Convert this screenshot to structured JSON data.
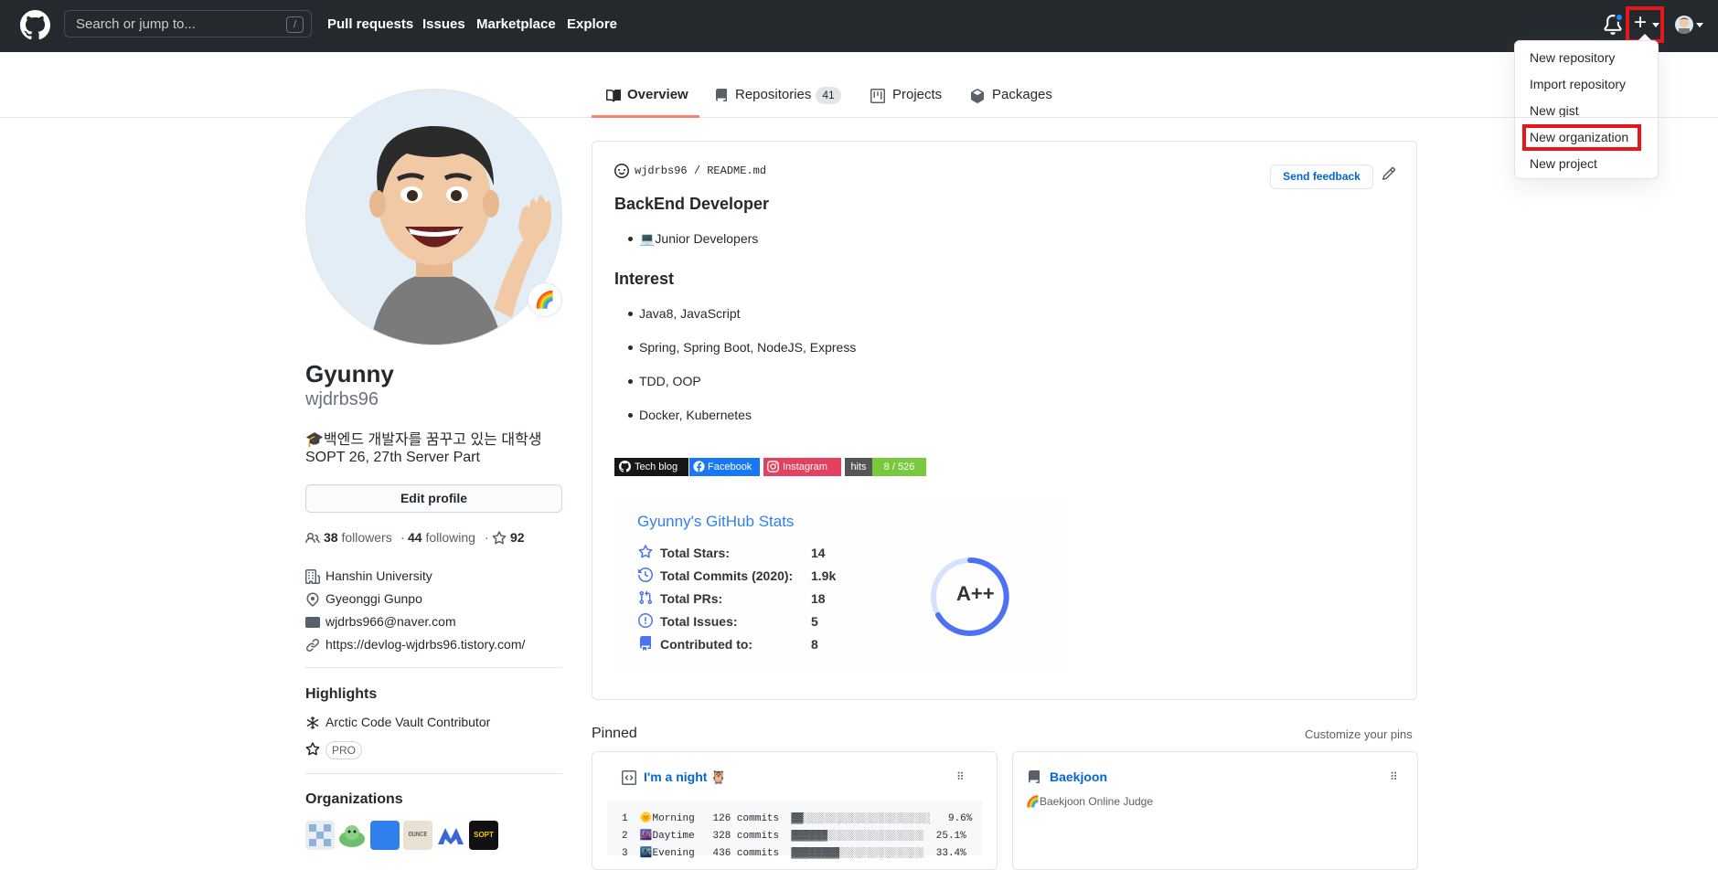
{
  "header": {
    "search_placeholder": "Search or jump to...",
    "slash": "/",
    "nav": [
      "Pull requests",
      "Issues",
      "Marketplace",
      "Explore"
    ],
    "plus": "+"
  },
  "dropdown": {
    "items": [
      "New repository",
      "Import repository",
      "New gist",
      "New organization",
      "New project"
    ]
  },
  "tabs": {
    "overview": "Overview",
    "repositories": "Repositories",
    "repo_count": "41",
    "projects": "Projects",
    "packages": "Packages"
  },
  "profile": {
    "status_emoji": "🌈",
    "name": "Gyunny",
    "login": "wjdrbs96",
    "bio_line1": "🎓백엔드 개발자를 꿈꾸고 있는 대학생",
    "bio_line2": "SOPT 26, 27th Server Part",
    "edit_profile": "Edit profile",
    "followers_count": "38",
    "followers_label": "followers",
    "sep": "·",
    "following_count": "44",
    "following_label": "following",
    "stars_count": "92",
    "company": "Hanshin University",
    "location": "Gyeonggi Gunpo",
    "email": "wjdrbs966@naver.com",
    "website": "https://devlog-wjdrbs96.tistory.com/"
  },
  "highlights": {
    "title": "Highlights",
    "arctic": "Arctic Code Vault Contributor",
    "pro": "PRO"
  },
  "organizations": {
    "title": "Organizations",
    "colors": [
      "#e8eef4",
      "#cfe3cf",
      "#2f80ed",
      "#e9e1d3",
      "#3c66d8",
      "#111111"
    ],
    "labels": [
      "",
      "",
      "",
      "OUNCE",
      "",
      "SOPT"
    ]
  },
  "readme": {
    "user": "wjdrbs96",
    "slash": "/",
    "file": "README.md",
    "send_feedback": "Send feedback",
    "heading1": "BackEnd Developer",
    "bullet1": "💻Junior Developers",
    "heading2": "Interest",
    "interests": [
      "Java8, JavaScript",
      "Spring, Spring Boot, NodeJS, Express",
      "TDD, OOP",
      "Docker, Kubernetes"
    ],
    "badges": {
      "techblog": "Tech blog",
      "facebook": "Facebook",
      "instagram": "Instagram",
      "hits_label": "hits",
      "hits_value": "8 / 526"
    }
  },
  "stats": {
    "title": "Gyunny's GitHub Stats",
    "rows": [
      {
        "label": "Total Stars:",
        "value": "14"
      },
      {
        "label": "Total Commits (2020):",
        "value": "1.9k"
      },
      {
        "label": "Total PRs:",
        "value": "18"
      },
      {
        "label": "Total Issues:",
        "value": "5"
      },
      {
        "label": "Contributed to:",
        "value": "8"
      }
    ],
    "grade": "A++"
  },
  "pinned": {
    "title": "Pinned",
    "customize": "Customize your pins",
    "card1_name": "I'm a night 🦉",
    "card1_lines": [
      "1  🌞Morning   126 commits  ▓▓░░░░░░░░░░░░░░░░░░░░░   9.6%",
      "2  🌆Daytime   328 commits  ▓▓▓▓▓▓░░░░░░░░░░░░░░░░  25.1%",
      "3  🌃Evening   436 commits  ▓▓▓▓▓▓▓▓░░░░░░░░░░░░░░  33.4%"
    ],
    "card2_name": "Baekjoon",
    "card2_desc": "🌈Baekjoon Online Judge"
  }
}
